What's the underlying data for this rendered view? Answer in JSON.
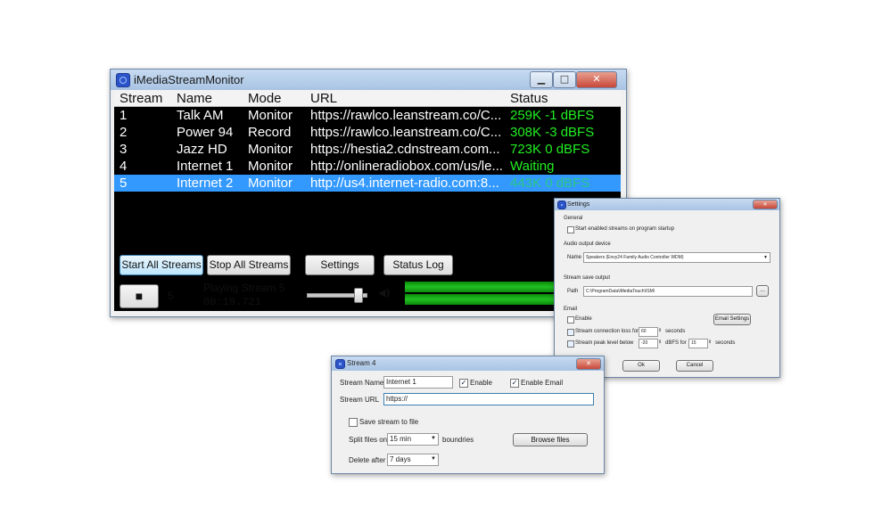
{
  "main_window": {
    "title": "iMediaStreamMonitor",
    "columns": [
      "Stream",
      "Name",
      "Mode",
      "URL",
      "Status"
    ],
    "rows": [
      {
        "stream": "1",
        "name": "Talk AM",
        "mode": "Monitor",
        "url": "https://rawlco.leanstream.co/C...",
        "status": "259K  -1 dBFS"
      },
      {
        "stream": "2",
        "name": "Power 94",
        "mode": "Record",
        "url": "https://rawlco.leanstream.co/C...",
        "status": "308K  -3 dBFS"
      },
      {
        "stream": "3",
        "name": "Jazz HD",
        "mode": "Monitor",
        "url": "https://hestia2.cdnstream.com...",
        "status": "723K  0 dBFS"
      },
      {
        "stream": "4",
        "name": "Internet 1",
        "mode": "Monitor",
        "url": "http://onlineradiobox.com/us/le...",
        "status": "Waiting"
      },
      {
        "stream": "5",
        "name": "Internet 2",
        "mode": "Monitor",
        "url": "http://us4.internet-radio.com:8...",
        "status": "443K  0 dBFS"
      }
    ],
    "selected_row": 4,
    "buttons": {
      "start_all": "Start All Streams",
      "stop_all": "Stop All Streams",
      "settings": "Settings",
      "status_log": "Status Log"
    },
    "player": {
      "stop_glyph": "■",
      "stream_number": "5",
      "playing_text": "Playing Stream 5",
      "elapsed": "00:19.721",
      "speaker_glyph": "◀)"
    },
    "title_buttons": {
      "minimize": "▁",
      "maximize": "□",
      "close": "✕"
    }
  },
  "settings_window": {
    "title": "Settings",
    "general_label": "General",
    "start_enabled_label": "Start enabled streams on program startup",
    "audio_output_label": "Audio output device",
    "name_label": "Name",
    "device_value": "Speakers (Envy24 Family Audio Controller WDM)",
    "stream_save_label": "Stream save output",
    "path_label": "Path",
    "path_value": "C:\\ProgramData\\iMediaTouch\\ISM\\",
    "browse_label": "...",
    "email_label": "Email",
    "enable_label": "Enable",
    "email_settings_button": "Email Settings",
    "connection_loss_label": "Stream connection loss for",
    "connection_loss_value": "60",
    "seconds_label": "seconds",
    "peak_level_label": "Stream peak level below",
    "peak_level_value": "-20",
    "dbfs_for_label": "dBFS for",
    "peak_seconds_value": "15",
    "seconds_label2": "seconds",
    "ok_button": "Ok",
    "cancel_button": "Cancel"
  },
  "stream4_window": {
    "title": "Stream 4",
    "stream_name_label": "Stream Name",
    "stream_name_value": "Internet 1",
    "enable_label": "Enable",
    "enable_email_label": "Enable Email",
    "stream_url_label": "Stream URL",
    "stream_url_value": "https://",
    "save_stream_label": "Save stream to file",
    "split_files_label": "Split files on",
    "split_files_value": "15 min",
    "boundries_label": "boundries",
    "browse_files_button": "Browse files",
    "delete_after_label": "Delete after",
    "delete_after_value": "7 days"
  }
}
